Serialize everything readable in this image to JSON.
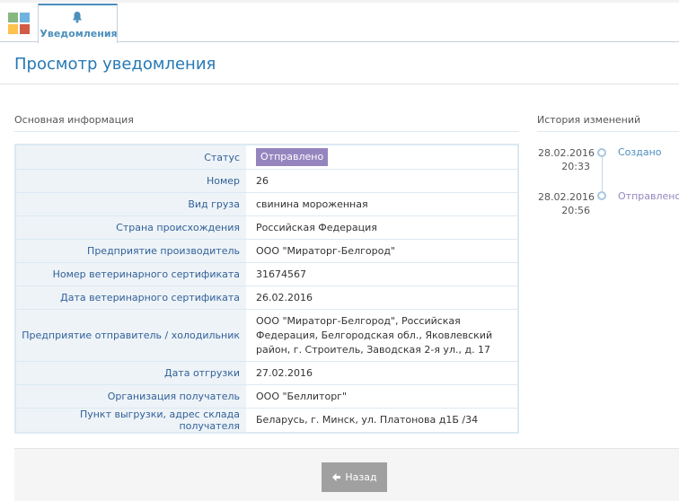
{
  "nav": {
    "tab_label": "Уведомления"
  },
  "page": {
    "title": "Просмотр уведомления"
  },
  "main_info": {
    "section_title": "Основная информация",
    "rows": [
      {
        "label": "Статус",
        "value": "Отправлено"
      },
      {
        "label": "Номер",
        "value": "26"
      },
      {
        "label": "Вид груза",
        "value": "свинина мороженная"
      },
      {
        "label": "Страна происхождения",
        "value": "Российская Федерация"
      },
      {
        "label": "Предприятие производитель",
        "value": "ООО \"Мираторг-Белгород\""
      },
      {
        "label": "Номер ветеринарного сертификата",
        "value": "31674567"
      },
      {
        "label": "Дата ветеринарного сертификата",
        "value": "26.02.2016"
      },
      {
        "label": "Предприятие отправитель / холодильник",
        "value": "ООО \"Мираторг-Белгород\", Российская Федерация, Белгородская обл., Яковлевский район, г. Строитель, Заводская 2-я ул., д. 17"
      },
      {
        "label": "Дата отгрузки",
        "value": "27.02.2016"
      },
      {
        "label": "Организация получатель",
        "value": "ООО \"Беллиторг\""
      },
      {
        "label": "Пункт выгрузки, адрес склада получателя",
        "value": "Беларусь, г. Минск, ул. Платонова д1Б /34"
      }
    ]
  },
  "history": {
    "section_title": "История изменений",
    "events": [
      {
        "date": "28.02.2016",
        "time": "20:33",
        "text": "Создано",
        "color": "#4c8fbd"
      },
      {
        "date": "28.02.2016",
        "time": "20:56",
        "text": "Отправлено",
        "color": "#9585bf"
      }
    ]
  },
  "footer": {
    "back_label": "Назад"
  },
  "colors": {
    "accent": "#2679b5",
    "status_badge": "#9585bf",
    "label_text": "#336199"
  },
  "icons": {
    "app_menu": "app-tiles-icon",
    "notifications": "bell-icon",
    "back": "arrow-left-icon"
  }
}
